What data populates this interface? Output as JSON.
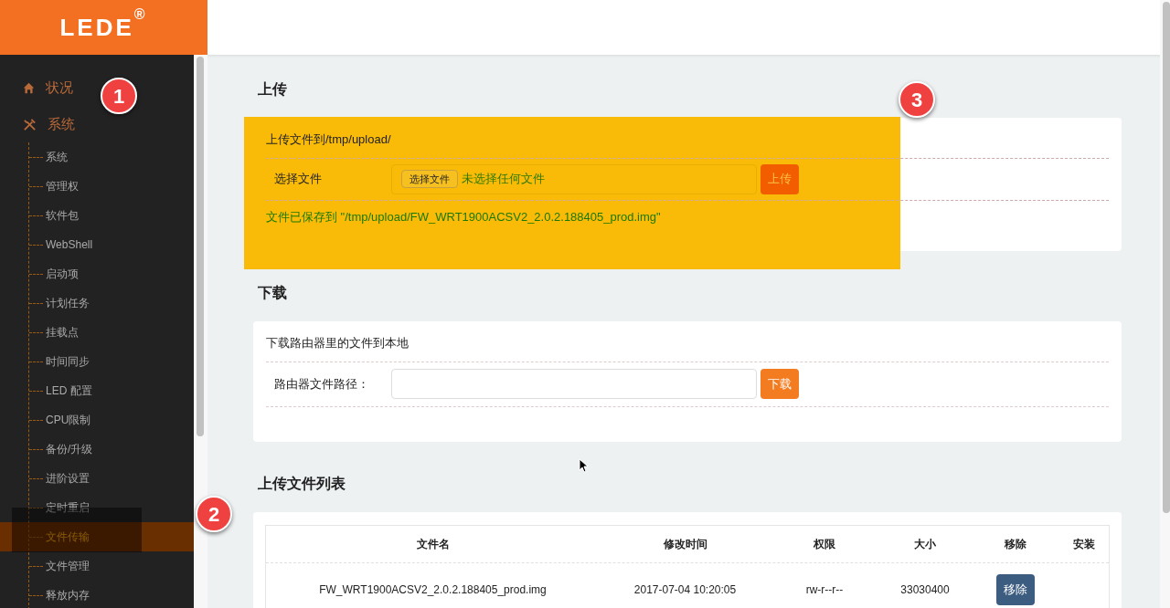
{
  "logo": {
    "text": "LEDE",
    "mark": "®"
  },
  "sidebar": {
    "menus": [
      {
        "label": "状况",
        "kind": "home"
      },
      {
        "label": "系统",
        "kind": "tools"
      }
    ],
    "items": [
      {
        "label": "系统",
        "selected": false
      },
      {
        "label": "管理权",
        "selected": false
      },
      {
        "label": "软件包",
        "selected": false
      },
      {
        "label": "WebShell",
        "selected": false
      },
      {
        "label": "启动项",
        "selected": false
      },
      {
        "label": "计划任务",
        "selected": false
      },
      {
        "label": "挂载点",
        "selected": false
      },
      {
        "label": "时间同步",
        "selected": false
      },
      {
        "label": "LED 配置",
        "selected": false
      },
      {
        "label": "CPU限制",
        "selected": false
      },
      {
        "label": "备份/升级",
        "selected": false
      },
      {
        "label": "进阶设置",
        "selected": false
      },
      {
        "label": "定时重启",
        "selected": false
      },
      {
        "label": "文件传输",
        "selected": true
      },
      {
        "label": "文件管理",
        "selected": false
      },
      {
        "label": "释放内存",
        "selected": false
      }
    ]
  },
  "upload": {
    "title": "上传",
    "description": "上传文件到/tmp/upload/",
    "field_label": "选择文件",
    "file_button": "选择文件",
    "file_status": "未选择任何文件",
    "button": "上传",
    "message": "文件已保存到 \"/tmp/upload/FW_WRT1900ACSV2_2.0.2.188405_prod.img\""
  },
  "download": {
    "title": "下载",
    "description": "下载路由器里的文件到本地",
    "field_label": "路由器文件路径：",
    "button": "下载"
  },
  "file_list": {
    "title": "上传文件列表",
    "columns": [
      "文件名",
      "修改时间",
      "权限",
      "大小",
      "移除",
      "安装"
    ],
    "rows": [
      {
        "name": "FW_WRT1900ACSV2_2.0.2.188405_prod.img",
        "modified": "2017-07-04 10:20:05",
        "permissions": "rw-r--r--",
        "size": "33030400",
        "remove": "移除"
      }
    ]
  },
  "annotations": [
    "1",
    "2",
    "3"
  ]
}
